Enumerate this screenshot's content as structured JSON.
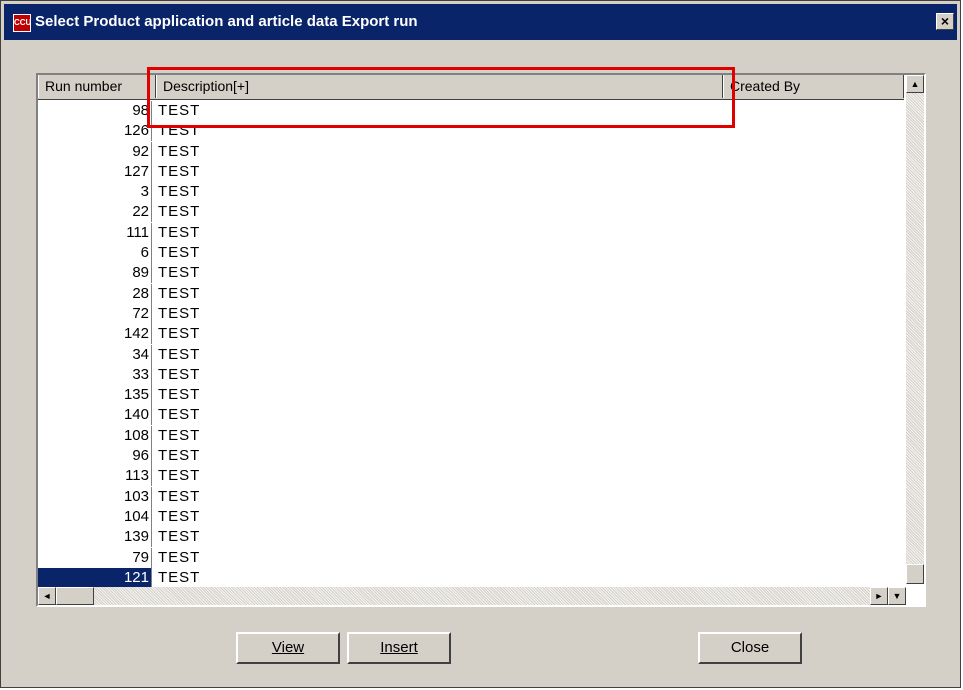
{
  "window": {
    "icon_text": "CCU",
    "title": "Select Product application and article data Export run",
    "close_glyph": "×"
  },
  "table": {
    "columns": [
      "Run number",
      "Description[+]",
      "Created By"
    ],
    "rows": [
      {
        "run": "98",
        "desc": "TEST"
      },
      {
        "run": "126",
        "desc": "TEST"
      },
      {
        "run": "92",
        "desc": "TEST"
      },
      {
        "run": "127",
        "desc": "TEST"
      },
      {
        "run": "3",
        "desc": "TEST"
      },
      {
        "run": "22",
        "desc": "TEST"
      },
      {
        "run": "111",
        "desc": "TEST"
      },
      {
        "run": "6",
        "desc": "TEST"
      },
      {
        "run": "89",
        "desc": "TEST"
      },
      {
        "run": "28",
        "desc": "TEST"
      },
      {
        "run": "72",
        "desc": "TEST"
      },
      {
        "run": "142",
        "desc": "TEST"
      },
      {
        "run": "34",
        "desc": "TEST"
      },
      {
        "run": "33",
        "desc": "TEST"
      },
      {
        "run": "135",
        "desc": "TEST"
      },
      {
        "run": "140",
        "desc": "TEST"
      },
      {
        "run": "108",
        "desc": "TEST"
      },
      {
        "run": "96",
        "desc": "TEST"
      },
      {
        "run": "113",
        "desc": "TEST"
      },
      {
        "run": "103",
        "desc": "TEST"
      },
      {
        "run": "104",
        "desc": "TEST"
      },
      {
        "run": "139",
        "desc": "TEST"
      },
      {
        "run": "79",
        "desc": "TEST"
      },
      {
        "run": "121",
        "desc": "TEST",
        "selected": true
      }
    ]
  },
  "buttons": {
    "view": "View",
    "insert": "Insert",
    "close": "Close"
  },
  "icons": {
    "scroll_up": "scroll-up-arrow-icon",
    "scroll_down": "scroll-down-arrow-icon",
    "scroll_left": "scroll-left-arrow-icon",
    "scroll_right": "scroll-right-arrow-icon"
  },
  "colors": {
    "titlebar": "#0a246a",
    "selection": "#0a246a",
    "highlight_box": "#e00000",
    "dialog_bg": "#d4d0c8"
  }
}
